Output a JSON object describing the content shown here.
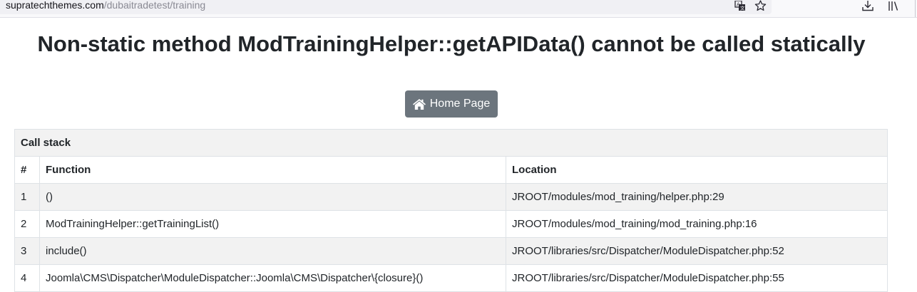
{
  "browser": {
    "url_domain": "supratechthemes.com",
    "url_path": "/dubaitradetest/training",
    "icons": [
      "translate-icon",
      "bookmark-star-icon",
      "download-icon",
      "library-icon"
    ]
  },
  "error": {
    "title": "Non-static method ModTrainingHelper::getAPIData() cannot be called statically"
  },
  "home_button": {
    "icon": "home-icon",
    "label": "Home Page",
    "color": "#6c757d"
  },
  "callstack": {
    "caption": "Call stack",
    "columns": [
      "#",
      "Function",
      "Location"
    ],
    "rows": [
      {
        "num": "1",
        "function": "()",
        "location": "JROOT/modules/mod_training/helper.php:29"
      },
      {
        "num": "2",
        "function": "ModTrainingHelper::getTrainingList()",
        "location": "JROOT/modules/mod_training/mod_training.php:16"
      },
      {
        "num": "3",
        "function": "include()",
        "location": "JROOT/libraries/src/Dispatcher/ModuleDispatcher.php:52"
      },
      {
        "num": "4",
        "function": "Joomla\\CMS\\Dispatcher\\ModuleDispatcher::Joomla\\CMS\\Dispatcher\\{closure}()",
        "location": "JROOT/libraries/src/Dispatcher/ModuleDispatcher.php:55"
      }
    ]
  }
}
